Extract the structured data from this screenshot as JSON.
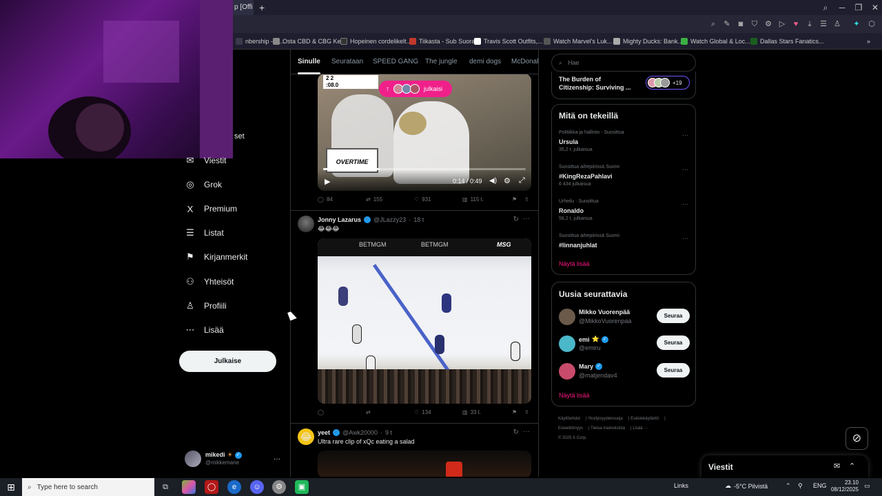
{
  "browser": {
    "tab_title": "p [Offi",
    "new_tab": "+",
    "bookmarks": [
      {
        "label": "nbership - G...",
        "color": "#3a3a4a"
      },
      {
        "label": "Osta CBD & CBG Ke...",
        "color": "#888888"
      },
      {
        "label": "Hopeinen cordelikelt...",
        "color": "#333333"
      },
      {
        "label": "Tiikasta - Sub Suora",
        "color": "#c0392b"
      },
      {
        "label": "Travis Scott Outfits,...",
        "color": "#ffffff"
      },
      {
        "label": "Watch Marvel's Luk...",
        "color": "#555555"
      },
      {
        "label": "Mighty Ducks: Bank...",
        "color": "#aaaaaa"
      },
      {
        "label": "Watch Global & Loc...",
        "color": "#3cb043"
      },
      {
        "label": "Dallas Stars Fanatics...",
        "color": "#1b5e20"
      }
    ]
  },
  "nav": {
    "partial_label": "set",
    "items": [
      {
        "label": "Viestit",
        "icon": "mail-icon",
        "glyph": "✉"
      },
      {
        "label": "Grok",
        "icon": "grok-icon",
        "glyph": "◎"
      },
      {
        "label": "Premium",
        "icon": "x-logo-icon",
        "glyph": "X"
      },
      {
        "label": "Listat",
        "icon": "list-icon",
        "glyph": "☰"
      },
      {
        "label": "Kirjanmerkit",
        "icon": "bookmark-icon",
        "glyph": "⚑"
      },
      {
        "label": "Yhteisöt",
        "icon": "communities-icon",
        "glyph": "⚇"
      },
      {
        "label": "Profiili",
        "icon": "profile-icon",
        "glyph": "♙"
      },
      {
        "label": "Lisää",
        "icon": "more-icon",
        "glyph": "⋯"
      }
    ],
    "post_label": "Julkaise",
    "account": {
      "name": "mikedi",
      "handle": "@mikkemane",
      "more": "···"
    }
  },
  "feed": {
    "tabs": [
      "Sinulle",
      "Seurataan",
      "SPEED GANG",
      "The jungle",
      "demi dogs",
      "McDonal"
    ],
    "repost_banner": "julkaisi",
    "post1": {
      "score_text": "2   2",
      "score_clock": ":08.0",
      "overlay": "OVERTIME",
      "time": "0:14 / 0:49",
      "replies": "84",
      "reposts": "155",
      "likes": "931",
      "views": "115 t."
    },
    "post2": {
      "name": "Jonny Lazarus",
      "handle": "@JLazzy23",
      "age": "18 t",
      "text": "😂😂😂",
      "broadcaster": "MSG",
      "sponsor": "BETMGM",
      "replies": "",
      "reposts": "",
      "likes": "134",
      "views": "33 t."
    },
    "post3": {
      "name": "yeet",
      "handle": "@Awk20000",
      "age": "9 t",
      "text": "Ultra rare clip of xQc eating a salad"
    }
  },
  "right": {
    "search_placeholder": "Hae",
    "top_snippet": {
      "title": "The Burden of Citizenship: Surviving ...",
      "badge": "+19"
    },
    "trends_title": "Mitä on tekeillä",
    "trends": [
      {
        "meta": "Politiikka ja hallinto · Suosittua",
        "name": "Ursula",
        "count": "35,2 t. julkaisua"
      },
      {
        "meta": "Suosittua aihepiirissä Suomi",
        "name": "#KingRezaPahlavi",
        "count": "6 434 julkaisua"
      },
      {
        "meta": "Urheilu · Suosittua",
        "name": "Ronaldo",
        "count": "58,2 t. julkaisua"
      },
      {
        "meta": "Suosittua aihepiirissä Suomi",
        "name": "#linnanjuhlat",
        "count": ""
      }
    ],
    "show_more": "Näytä lisää",
    "who_title": "Uusia seurattavia",
    "who": [
      {
        "name": "Mikko Vuorenpää",
        "handle": "@MikkoVuorenpaa",
        "badge": "",
        "follow": "Seuraa",
        "color": "#6b5a4a"
      },
      {
        "name": "emi",
        "handle": "@emiru",
        "badge": "⭐",
        "follow": "Seuraa",
        "color": "#4ab8c9"
      },
      {
        "name": "Mary",
        "handle": "@matjendav4",
        "badge": "",
        "follow": "Seuraa",
        "color": "#c84b6b"
      }
    ],
    "who_more": "Näytä lisää",
    "footer": [
      "Käyttöehdot",
      "Yksityisyydensuoja",
      "Evästekäytäntö",
      "Esteettömyys",
      "Tietoa mainoksista",
      "Lisää ···",
      "© 2025 X Corp."
    ],
    "messages_title": "Viestit"
  },
  "taskbar": {
    "search_placeholder": "Type here to search",
    "links": "Links",
    "weather": "-5°C Pilvistä",
    "lang": "ENG",
    "time": "23.10",
    "date": "08/12/2025"
  },
  "colors": {
    "accent": "#f91880",
    "verified": "#1d9bf0",
    "background": "#000000"
  }
}
